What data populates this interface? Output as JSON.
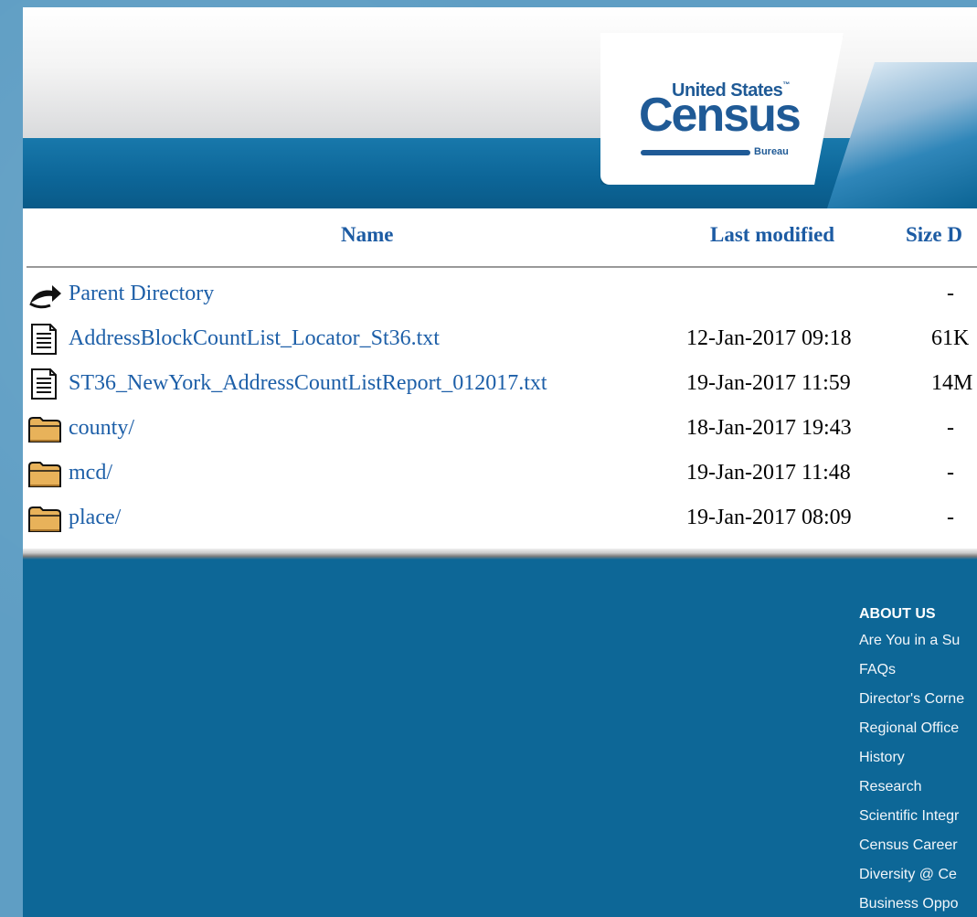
{
  "logo": {
    "line1": "United States",
    "tm": "™",
    "main": "Census",
    "sub": "Bureau"
  },
  "table": {
    "headers": {
      "name": "Name",
      "last_modified": "Last modified",
      "size": "Size D"
    },
    "rows": [
      {
        "name": "Parent Directory",
        "date": "",
        "size": "-",
        "icon": "parent-directory-icon"
      },
      {
        "name": "AddressBlockCountList_Locator_St36.txt",
        "date": "12-Jan-2017 09:18",
        "size": "61K",
        "icon": "text-file-icon"
      },
      {
        "name": "ST36_NewYork_AddressCountListReport_012017.txt",
        "date": "19-Jan-2017 11:59",
        "size": "14M",
        "icon": "text-file-icon"
      },
      {
        "name": "county/",
        "date": "18-Jan-2017 19:43",
        "size": "-",
        "icon": "folder-icon"
      },
      {
        "name": "mcd/",
        "date": "19-Jan-2017 11:48",
        "size": "-",
        "icon": "folder-icon"
      },
      {
        "name": "place/",
        "date": "19-Jan-2017 08:09",
        "size": "-",
        "icon": "folder-icon"
      }
    ]
  },
  "footer": {
    "title": "ABOUT US",
    "links": [
      "Are You in a Su",
      "FAQs",
      "Director's Corne",
      "Regional Office",
      "History",
      "Research",
      "Scientific Integr",
      "Census Career",
      "Diversity @ Ce",
      "Business Oppo"
    ]
  }
}
